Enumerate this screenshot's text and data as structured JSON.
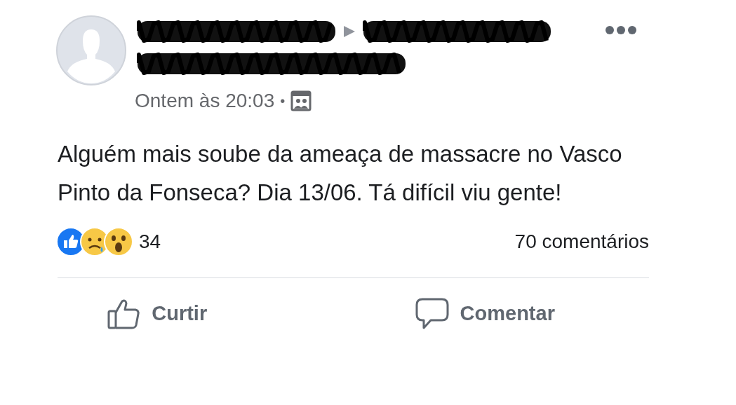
{
  "post": {
    "timestamp": "Ontem às 20:03",
    "separator": "•",
    "text": "Alguém mais soube da ameaça de massacre no Vasco Pinto da Fonseca? Dia 13/06. Tá difícil viu gente!",
    "reactions": [
      {
        "kind": "like"
      },
      {
        "kind": "sad"
      },
      {
        "kind": "wow"
      }
    ],
    "reaction_count": "34",
    "comments": "70 comentários",
    "actions": [
      {
        "kind": "like",
        "label": "Curtir"
      },
      {
        "kind": "comment",
        "label": "Comentar"
      }
    ]
  }
}
